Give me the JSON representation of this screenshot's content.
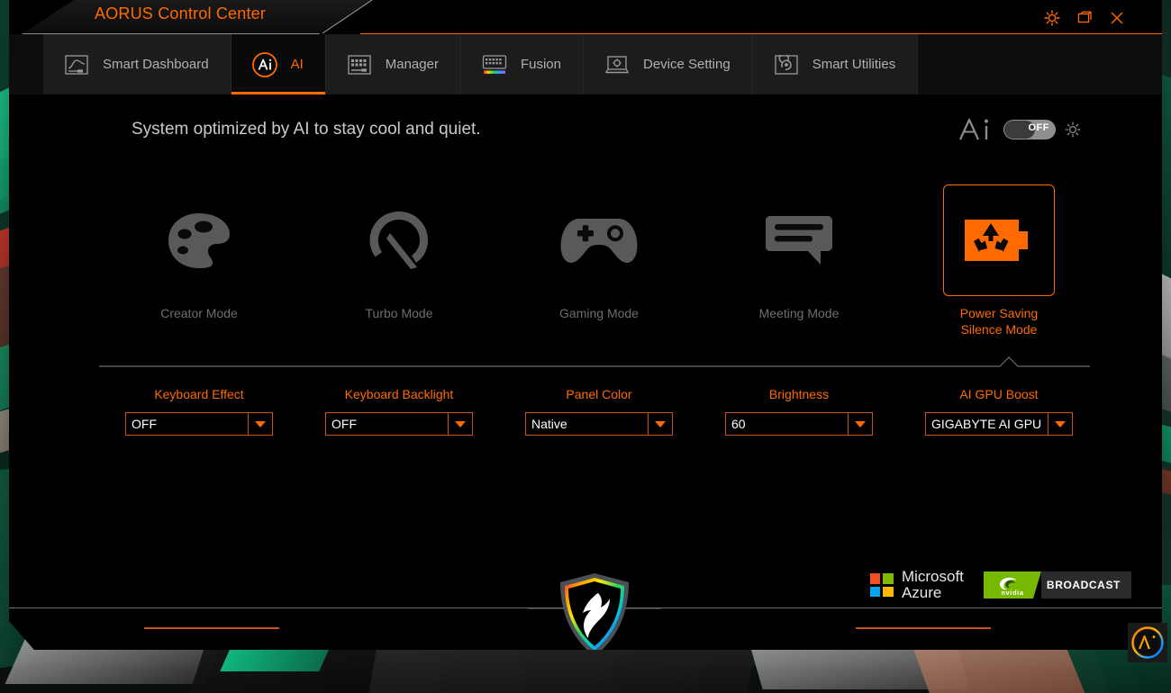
{
  "window": {
    "title": "AORUS Control Center",
    "controls": [
      {
        "name": "settings-icon",
        "label": "Settings"
      },
      {
        "name": "maximize-icon",
        "label": "Maximize"
      },
      {
        "name": "close-icon",
        "label": "Close"
      }
    ],
    "accent_color": "#ff6a00",
    "background_color": "#000000"
  },
  "tabs": [
    {
      "id": "smart-dashboard",
      "label": "Smart Dashboard",
      "icon": "chart-monitor-icon",
      "active": false
    },
    {
      "id": "ai",
      "label": "AI",
      "icon": "ai-circle-icon",
      "active": true
    },
    {
      "id": "manager",
      "label": "Manager",
      "icon": "keyboard-manager-icon",
      "active": false
    },
    {
      "id": "fusion",
      "label": "Fusion",
      "icon": "rgb-keyboard-icon",
      "active": false
    },
    {
      "id": "device-setting",
      "label": "Device Setting",
      "icon": "laptop-gear-icon",
      "active": false
    },
    {
      "id": "smart-utilities",
      "label": "Smart Utilities",
      "icon": "utilities-refresh-icon",
      "active": false
    }
  ],
  "main": {
    "headline": "System optimized by AI to stay cool and quiet.",
    "ai_master": {
      "wordmark": "Ai",
      "toggle_state": "OFF",
      "toggle_label": "OFF",
      "brightness_icon": "sun-icon"
    },
    "modes": [
      {
        "id": "creator",
        "label": "Creator Mode",
        "icon": "palette-icon",
        "selected": false
      },
      {
        "id": "turbo",
        "label": "Turbo Mode",
        "icon": "gauge-icon",
        "selected": false
      },
      {
        "id": "gaming",
        "label": "Gaming Mode",
        "icon": "gamepad-icon",
        "selected": false
      },
      {
        "id": "meeting",
        "label": "Meeting Mode",
        "icon": "chat-bubble-icon",
        "selected": false
      },
      {
        "id": "power-saving",
        "label": "Power Saving\nSilence Mode",
        "label_line1": "Power Saving",
        "label_line2": "Silence Mode",
        "icon": "battery-recycle-icon",
        "selected": true
      }
    ],
    "settings": [
      {
        "id": "keyboard-effect",
        "label": "Keyboard Effect",
        "value": "OFF"
      },
      {
        "id": "keyboard-backlight",
        "label": "Keyboard Backlight",
        "value": "OFF"
      },
      {
        "id": "panel-color",
        "label": "Panel Color",
        "value": "Native"
      },
      {
        "id": "brightness",
        "label": "Brightness",
        "value": "60"
      },
      {
        "id": "ai-gpu-boost",
        "label": "AI GPU Boost",
        "value": "GIGABYTE AI GPU"
      }
    ],
    "partners": {
      "microsoft": {
        "line1": "Microsoft",
        "line2": "Azure",
        "icon": "microsoft-squares-icon"
      },
      "nvidia": {
        "brand": "nvidia",
        "product": "BROADCAST",
        "icon": "nvidia-eye-icon"
      }
    }
  },
  "footer": {
    "logo": "aorus-falcon-badge"
  },
  "floating_widget": {
    "label": "Ai",
    "icon": "ai-gradient-badge"
  }
}
